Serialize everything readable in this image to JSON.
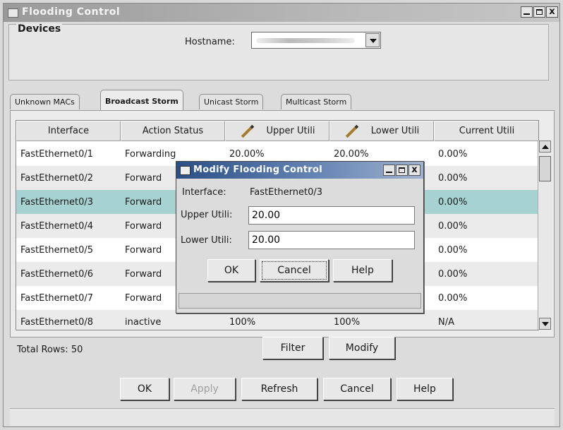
{
  "window": {
    "title": "Flooding Control"
  },
  "devices": {
    "legend": "Devices",
    "hostname_label": "Hostname:"
  },
  "tabs": [
    {
      "label": "Unknown MACs"
    },
    {
      "label": "Broadcast Storm"
    },
    {
      "label": "Unicast Storm"
    },
    {
      "label": "Multicast Storm"
    }
  ],
  "table": {
    "columns": [
      "Interface",
      "Action Status",
      "Upper Utili",
      "Lower Utili",
      "Current Utili"
    ],
    "rows": [
      [
        "FastEthernet0/1",
        "Forwarding",
        "20.00%",
        "20.00%",
        "0.00%"
      ],
      [
        "FastEthernet0/2",
        "Forward",
        "",
        "",
        "0.00%"
      ],
      [
        "FastEthernet0/3",
        "Forward",
        "",
        "",
        "0.00%"
      ],
      [
        "FastEthernet0/4",
        "Forward",
        "",
        "",
        "0.00%"
      ],
      [
        "FastEthernet0/5",
        "Forward",
        "",
        "",
        "0.00%"
      ],
      [
        "FastEthernet0/6",
        "Forward",
        "",
        "",
        "0.00%"
      ],
      [
        "FastEthernet0/7",
        "Forward",
        "",
        "",
        "0.00%"
      ],
      [
        "FastEthernet0/8",
        "inactive",
        "100%",
        "100%",
        "N/A"
      ]
    ],
    "total_rows": "Total Rows: 50"
  },
  "panel_buttons": {
    "filter": "Filter",
    "modify": "Modify"
  },
  "footer_buttons": {
    "ok": "OK",
    "apply": "Apply",
    "refresh": "Refresh",
    "cancel": "Cancel",
    "help": "Help"
  },
  "dialog": {
    "title": "Modify Flooding Control",
    "interface_label": "Interface:",
    "interface_value": "FastEthernet0/3",
    "upper_label": "Upper Utili:",
    "upper_value": "20.00",
    "lower_label": "Lower Utili:",
    "lower_value": "20.00",
    "ok": "OK",
    "cancel": "Cancel",
    "help": "Help"
  }
}
